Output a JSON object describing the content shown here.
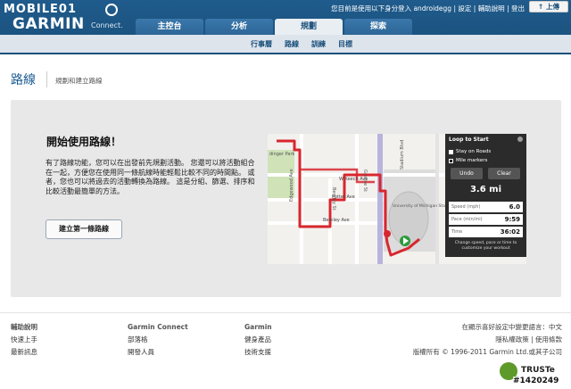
{
  "brand": {
    "mobile": "MOBILE01",
    "garmin": "GARMIN",
    "connect": "Connect."
  },
  "header_links": {
    "login_prefix": "您目前是使用以下身分登入 androidegg",
    "settings": "設定",
    "help": "輔助說明",
    "logout": "登出"
  },
  "upload": "↑ 上傳",
  "tabs": [
    "主控台",
    "分析",
    "規劃",
    "探索"
  ],
  "subnav": [
    "行事曆",
    "路線",
    "訓練",
    "目標"
  ],
  "page": {
    "title": "路線",
    "subtitle": "規劃和建立路線"
  },
  "hero": {
    "title": "開始使用路線！",
    "text": "有了路線功能，您可以在出發前先規劃活動。 您還可以將活動組合在一起，方便您在使用同一條航線時能輕鬆比較不同的時間點。 或者，您也可以將過去的活動轉換為路線。 這是分組、篩選、排序和比較活動最簡單的方法。",
    "cta": "建立第一條路線"
  },
  "map": {
    "labels": [
      "W Keech Ave",
      "Potter Ave",
      "Berkley Ave",
      "University of Michigan Stadium",
      "dinger Park",
      "Stadium Blvd",
      "Greene St",
      "Berkley St",
      "Edgewood Ave"
    ],
    "panel": {
      "title": "Loop to Start",
      "stay_on_roads": "Stay on Roads",
      "mile_markers": "Mile markers",
      "undo": "Undo",
      "clear": "Clear",
      "distance": "3.6 mi",
      "rows": [
        {
          "label": "Speed (mph)",
          "value": "6.0"
        },
        {
          "label": "Pace (min/mi)",
          "value": "9:59"
        },
        {
          "label": "Time",
          "value": "36:02"
        }
      ],
      "footer": "Change speed, pace or time to customize your workout"
    }
  },
  "footer": {
    "col1": {
      "head": "輔助說明",
      "items": [
        "快速上手",
        "最新訊息"
      ]
    },
    "col2": {
      "head": "Garmin Connect",
      "items": [
        "部落格",
        "開發人員"
      ]
    },
    "col3": {
      "head": "Garmin",
      "items": [
        "健身產品",
        "技術支援"
      ]
    },
    "lang": "在顯示喜好設定中變更語言：中文",
    "privacy": "隱私權政策 | 使用條款",
    "copyright": "版權所有 © 1996-2011 Garmin Ltd.或其子公司",
    "truste": "TRUSTe",
    "watermark": "#1420249"
  }
}
